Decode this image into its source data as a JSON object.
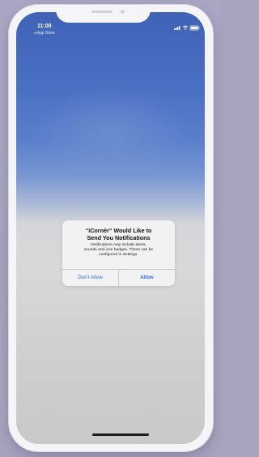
{
  "status_bar": {
    "time": "11:00",
    "back_label": "◂ App Store"
  },
  "alert": {
    "title_line1": "“iCornèr” Would Like to",
    "title_line2": "Send You Notifications",
    "message_line1": "Notifications may include alerts,",
    "message_line2": "sounds and icon badges. These can be",
    "message_line3": "configured in Settings.",
    "deny_label": "Don’t Allow",
    "allow_label": "Allow"
  },
  "colors": {
    "accent": "#2f6de0",
    "wallpaper_top": "#3f63b6",
    "wallpaper_bottom": "#c9c9c9",
    "backdrop": "#a7a4c0"
  },
  "icons": {
    "signal": "signal-icon",
    "wifi": "wifi-icon",
    "battery": "battery-icon"
  }
}
